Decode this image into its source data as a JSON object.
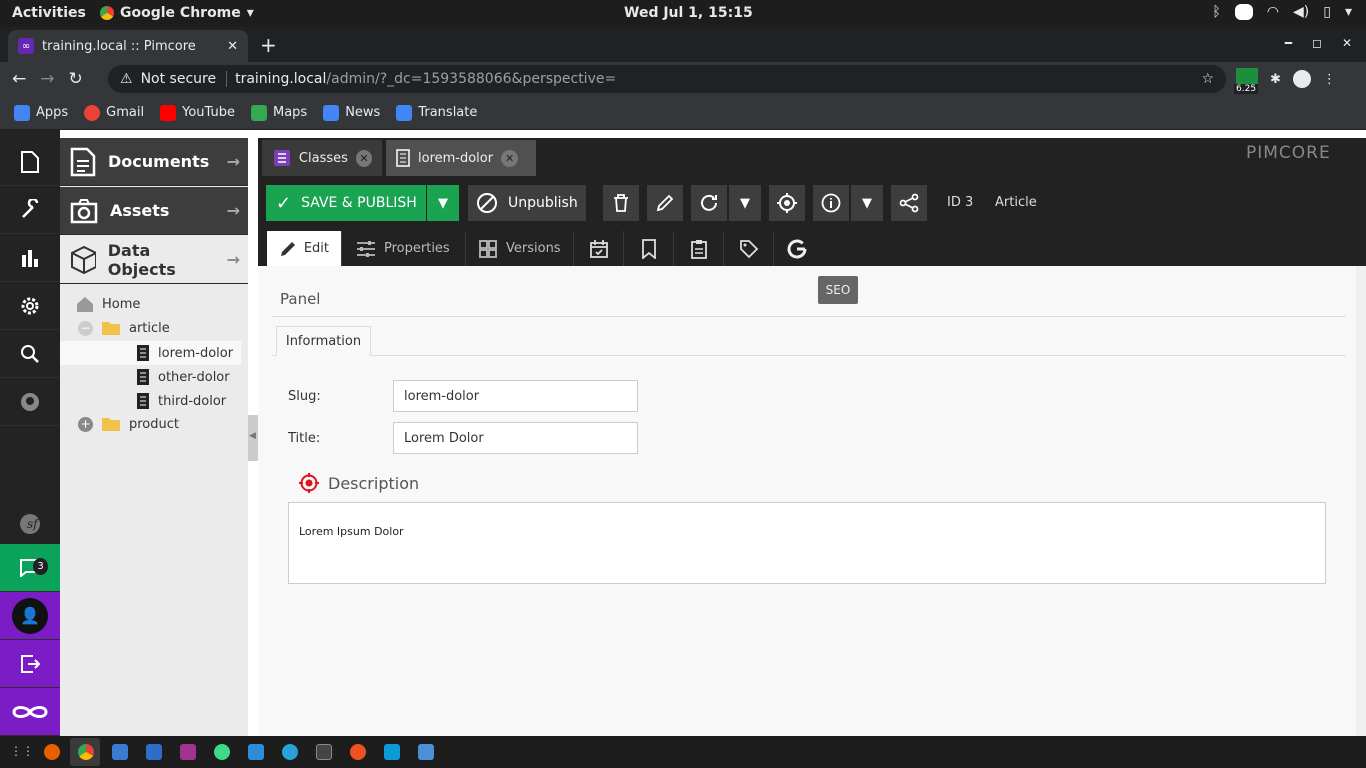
{
  "system_bar": {
    "activities": "Activities",
    "app_name": "Google Chrome",
    "clock": "Wed Jul  1, 15:15"
  },
  "browser": {
    "tab_title": "training.local :: Pimcore",
    "security_label": "Not secure",
    "url_host": "training.local",
    "url_path": "/admin/?_dc=1593588066&perspective=",
    "extension_badge": "6.25",
    "bookmarks": [
      {
        "label": "Apps",
        "icon": "apps-grid-icon",
        "color": "#4285f4"
      },
      {
        "label": "Gmail",
        "icon": "google-icon",
        "color": "#ea4335"
      },
      {
        "label": "YouTube",
        "icon": "youtube-icon",
        "color": "#ff0000"
      },
      {
        "label": "Maps",
        "icon": "maps-icon",
        "color": "#34a853"
      },
      {
        "label": "News",
        "icon": "news-icon",
        "color": "#4285f4"
      },
      {
        "label": "Translate",
        "icon": "translate-icon",
        "color": "#4285f4"
      }
    ]
  },
  "pimcore": {
    "logo": "PIMCORE",
    "notification_count": "3",
    "tree": {
      "sections": [
        {
          "label": "Documents",
          "icon": "document-icon"
        },
        {
          "label": "Assets",
          "icon": "camera-icon"
        },
        {
          "label": "Data Objects",
          "icon": "cube-icon"
        }
      ],
      "nodes": {
        "home": "Home",
        "article": "article",
        "lorem": "lorem-dolor",
        "other": "other-dolor",
        "third": "third-dolor",
        "product": "product"
      }
    },
    "editor_tabs": {
      "classes": "Classes",
      "object": "lorem-dolor"
    },
    "toolbar": {
      "save_publish": "SAVE & PUBLISH",
      "unpublish": "Unpublish",
      "id": "ID 3",
      "class_name": "Article"
    },
    "subtabs": {
      "edit": "Edit",
      "properties": "Properties",
      "versions": "Versions"
    },
    "tooltip": "SEO",
    "panel": {
      "title": "Panel",
      "tab": "Information",
      "slug_label": "Slug:",
      "slug_value": "lorem-dolor",
      "title_label": "Title:",
      "title_value": "Lorem Dolor",
      "description_heading": "Description",
      "description_text": "Lorem Ipsum Dolor"
    },
    "colors": {
      "save_green": "#1aa350",
      "notification_green": "#0aa35a",
      "user_purple": "#7c1cc7"
    }
  }
}
